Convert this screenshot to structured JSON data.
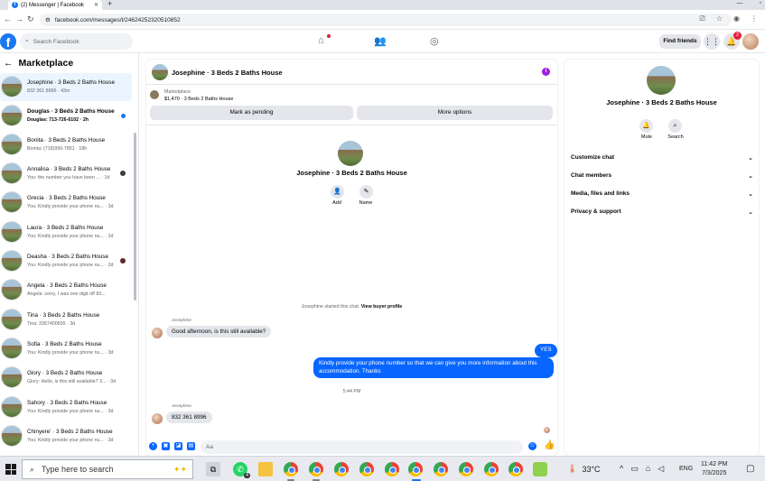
{
  "browser": {
    "tab_title": "(2) Messenger | Facebook",
    "new_tab": "+",
    "url": "facebook.com/messages/t/24624252320510852"
  },
  "header": {
    "search_placeholder": "Search Facebook",
    "find_friends": "Find friends",
    "notification_count": "2"
  },
  "left": {
    "title": "Marketplace",
    "conversations": [
      {
        "name": "Josephine · 3 Beds 2 Baths House",
        "snippet": "832 361 8996 · 43m",
        "selected": true
      },
      {
        "name": "Douglas · 3 Beds 2 Baths House",
        "snippet": "Douglas: 713-726-6102 · 2h",
        "unread": true
      },
      {
        "name": "Bonita · 3 Beds 2 Baths House",
        "snippet": "Bonita: (718)990-7851 · 18h"
      },
      {
        "name": "Annalisa · 3 Beds 2 Baths House",
        "snippet": "You: the number you have been ... · 1d"
      },
      {
        "name": "Grecia · 3 Beds 2 Baths House",
        "snippet": "You: Kindly provide your phone nu... · 3d"
      },
      {
        "name": "Laura · 3 Beds 2 Baths House",
        "snippet": "You: Kindly provide your phone nu... · 2d"
      },
      {
        "name": "Deasha · 3 Beds 2 Baths House",
        "snippet": "You: Kindly provide your phone nu... · 2d"
      },
      {
        "name": "Angela · 3 Beds 2 Baths House",
        "snippet": "Angela: sorry, I was one digit off 83..."
      },
      {
        "name": "Tina · 3 Beds 2 Baths House",
        "snippet": "Tina: 3367400695 · 3d"
      },
      {
        "name": "Sofia · 3 Beds 2 Baths House",
        "snippet": "You: Kindly provide your phone nu... · 3d"
      },
      {
        "name": "Glory · 3 Beds 2 Baths House",
        "snippet": "Glory: Hello, is this still available? 3... · 3d"
      },
      {
        "name": "Sahory · 3 Beds 2 Baths House",
        "snippet": "You: Kindly provide your phone nu... · 3d"
      },
      {
        "name": "Chinyere' · 3 Beds 2 Baths House",
        "snippet": "You: Kindly provide your phone nu... · 3d"
      }
    ]
  },
  "chat": {
    "title": "Josephine · 3 Beds 2 Baths House",
    "info_icon": "i",
    "marketplace_label": "Marketplace",
    "listing": "$1,470 · 3 Beds 2 Baths House",
    "mark_pending": "Mark as pending",
    "more_options": "More options",
    "profile_name": "Josephine · 3 Beds 2 Baths House",
    "add_label": "Add",
    "name_label": "Name",
    "start_note": "Josephine started this chat.",
    "view_profile": "View buyer profile",
    "sender1": "Josephine",
    "msg1": "Good afternoon, is this still available?",
    "out1": "YES",
    "out2": "Kindly provide your phone number so that we can give you more information about this accommodation. Thanks",
    "time": "5:44 PM",
    "sender2": "Josephine",
    "msg2": "832 361 8996",
    "input_placeholder": "Aa"
  },
  "right": {
    "name": "Josephine · 3 Beds 2 Baths House",
    "mute": "Mute",
    "search": "Search",
    "items": [
      "Customize chat",
      "Chat members",
      "Media, files and links",
      "Privacy & support"
    ]
  },
  "taskbar": {
    "search_placeholder": "Type here to search",
    "whatsapp_badge": "4",
    "temperature": "33°C",
    "language": "ENG",
    "time": "11:42 PM",
    "date": "7/3/2025"
  }
}
